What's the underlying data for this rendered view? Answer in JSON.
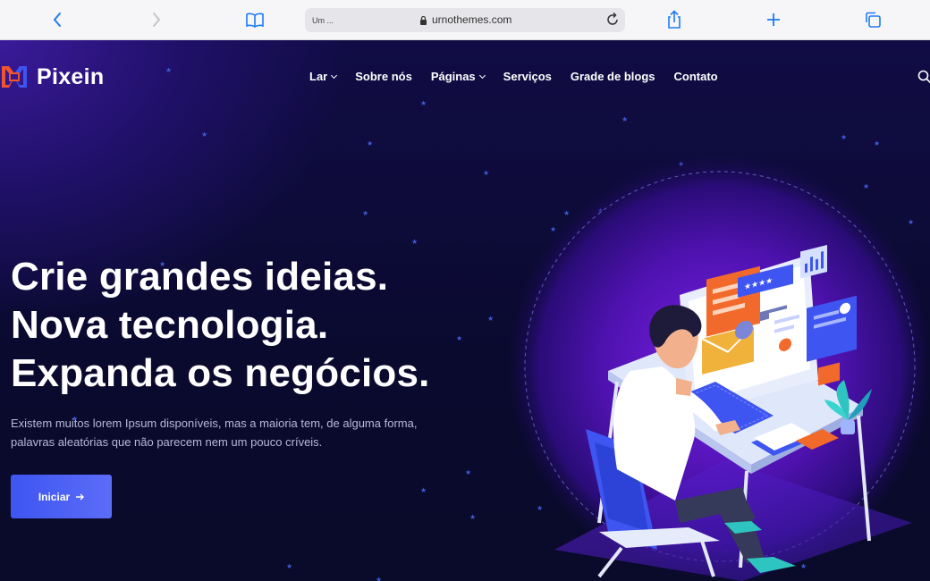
{
  "browser": {
    "tab_title": "Um ...",
    "url": "urnothemes.com"
  },
  "brand": {
    "name": "Pixein"
  },
  "nav": [
    {
      "label": "Lar",
      "has_dropdown": true
    },
    {
      "label": "Sobre nós",
      "has_dropdown": false
    },
    {
      "label": "Páginas",
      "has_dropdown": true
    },
    {
      "label": "Serviços",
      "has_dropdown": false
    },
    {
      "label": "Grade de blogs",
      "has_dropdown": false
    },
    {
      "label": "Contato",
      "has_dropdown": false
    }
  ],
  "hero": {
    "title_lines": [
      "Crie grandes ideias.",
      "Nova tecnologia.",
      "Expanda os negócios."
    ],
    "subtitle": "Existem muitos lorem Ipsum disponíveis, mas a maioria tem, de alguma forma, palavras aleatórias que não parecem nem um pouco críveis.",
    "cta_label": "Iniciar",
    "cta_icon": "arrow-right-icon"
  },
  "colors": {
    "accent": "#3e55f1",
    "background": "#0c0930",
    "logo_orange": "#f0542d",
    "logo_blue": "#3e55f1"
  }
}
